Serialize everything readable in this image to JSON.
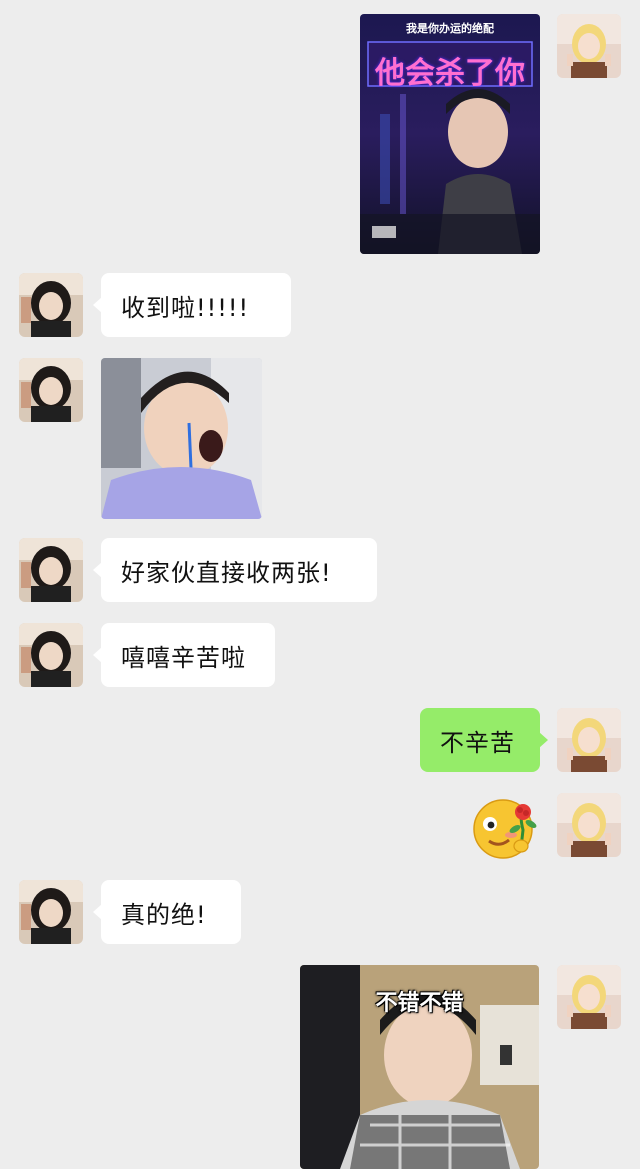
{
  "messages": [
    {
      "type": "image",
      "side": "out",
      "content": "poster",
      "image_text": {
        "top_banner": "我是你办运的绝配",
        "title": "他会杀了你"
      }
    },
    {
      "type": "text",
      "side": "in",
      "text": "收到啦!!!!!"
    },
    {
      "type": "image",
      "side": "in",
      "content": "crying-face-sticker"
    },
    {
      "type": "text",
      "side": "in",
      "text": "好家伙直接收两张!"
    },
    {
      "type": "text",
      "side": "in",
      "text": "嘻嘻辛苦啦"
    },
    {
      "type": "text",
      "side": "out",
      "text": "不辛苦"
    },
    {
      "type": "emoji",
      "side": "out",
      "icon": "rose-smile-emoji-icon"
    },
    {
      "type": "text",
      "side": "in",
      "text": "真的绝!"
    },
    {
      "type": "image",
      "side": "out",
      "content": "meme-sticker",
      "caption": "不错不错"
    }
  ],
  "colors": {
    "background": "#ededed",
    "incoming_bubble": "#ffffff",
    "outgoing_bubble": "#95ec69"
  }
}
